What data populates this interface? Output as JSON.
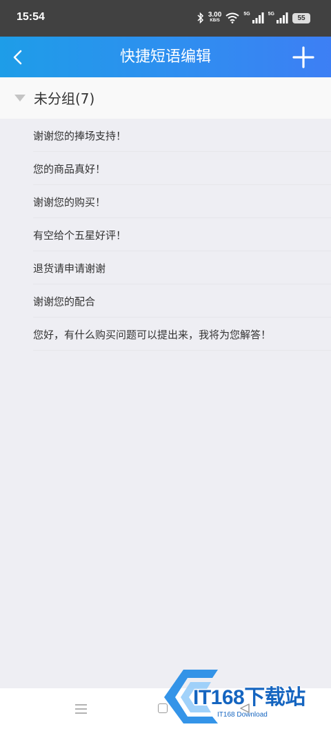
{
  "status_bar": {
    "time": "15:54",
    "speed_value": "3.00",
    "speed_unit": "KB/S",
    "net1": "5G",
    "net2": "5G",
    "battery": "55"
  },
  "navbar": {
    "title": "快捷短语编辑",
    "back_icon": "chevron-left-icon",
    "add_icon": "plus-icon"
  },
  "group": {
    "title": "未分组(7)",
    "expanded": true
  },
  "phrases": [
    "谢谢您的捧场支持！",
    "您的商品真好！",
    "谢谢您的购买！",
    "有空给个五星好评！",
    "退货请申请谢谢",
    "谢谢您的配合",
    "您好，有什么购买问题可以提出来，我将为您解答！"
  ],
  "watermark": {
    "text": "IT168下载站",
    "sub": "IT168 Download"
  },
  "colors": {
    "nav_gradient_start": "#1e9de8",
    "nav_gradient_end": "#3d7ff4",
    "statusbar": "#414141",
    "background": "#eeeef3"
  }
}
